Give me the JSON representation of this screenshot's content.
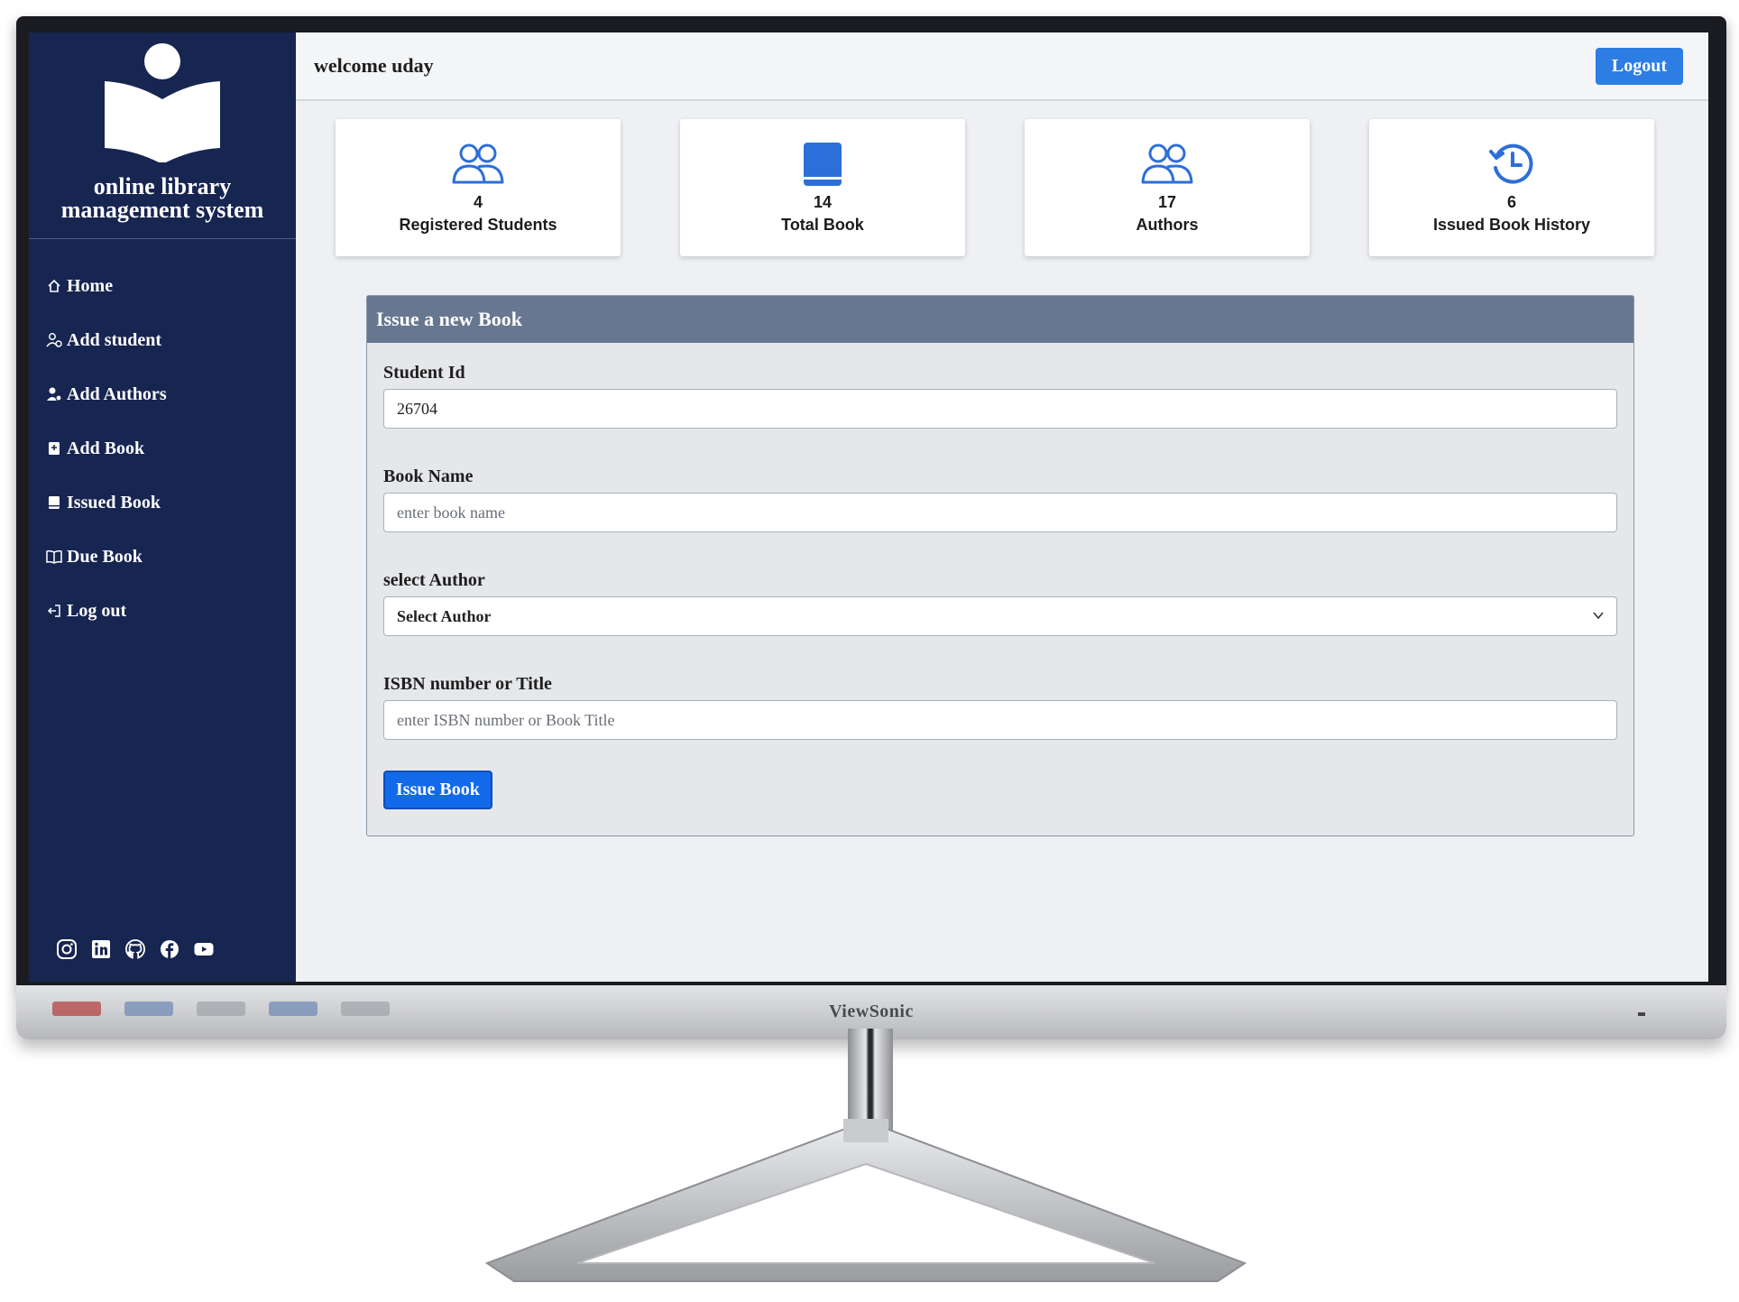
{
  "brand": {
    "title_line1": "online library",
    "title_line2": "management system"
  },
  "sidebar": {
    "items": [
      {
        "label": "Home",
        "icon": "home-icon"
      },
      {
        "label": "Add student",
        "icon": "user-plus-icon"
      },
      {
        "label": "Add Authors",
        "icon": "user-gear-icon"
      },
      {
        "label": "Add Book",
        "icon": "book-plus-icon"
      },
      {
        "label": "Issued Book",
        "icon": "book-icon"
      },
      {
        "label": "Due Book",
        "icon": "open-book-icon"
      },
      {
        "label": "Log out",
        "icon": "logout-icon"
      }
    ],
    "social": [
      "instagram-icon",
      "linkedin-icon",
      "github-icon",
      "facebook-icon",
      "youtube-icon"
    ]
  },
  "header": {
    "welcome": "welcome uday",
    "logout_label": "Logout"
  },
  "stats": [
    {
      "value": "4",
      "label": "Registered Students",
      "icon": "users-icon"
    },
    {
      "value": "14",
      "label": "Total Book",
      "icon": "book-icon"
    },
    {
      "value": "17",
      "label": "Authors",
      "icon": "users-icon"
    },
    {
      "value": "6",
      "label": "Issued Book History",
      "icon": "history-icon"
    }
  ],
  "form": {
    "title": "Issue a new Book",
    "student_id": {
      "label": "Student Id",
      "value": "26704"
    },
    "book_name": {
      "label": "Book Name",
      "placeholder": "enter book name"
    },
    "author": {
      "label": "select Author",
      "selected": "Select Author"
    },
    "isbn": {
      "label": "ISBN number or Title",
      "placeholder": "enter ISBN number or Book Title"
    },
    "submit_label": "Issue Book"
  },
  "monitor": {
    "brand": "ViewSonic"
  },
  "colors": {
    "sidebar": "#172551",
    "accent": "#1269ea",
    "panel_header": "#687790",
    "icon_blue": "#2d6fd8"
  }
}
